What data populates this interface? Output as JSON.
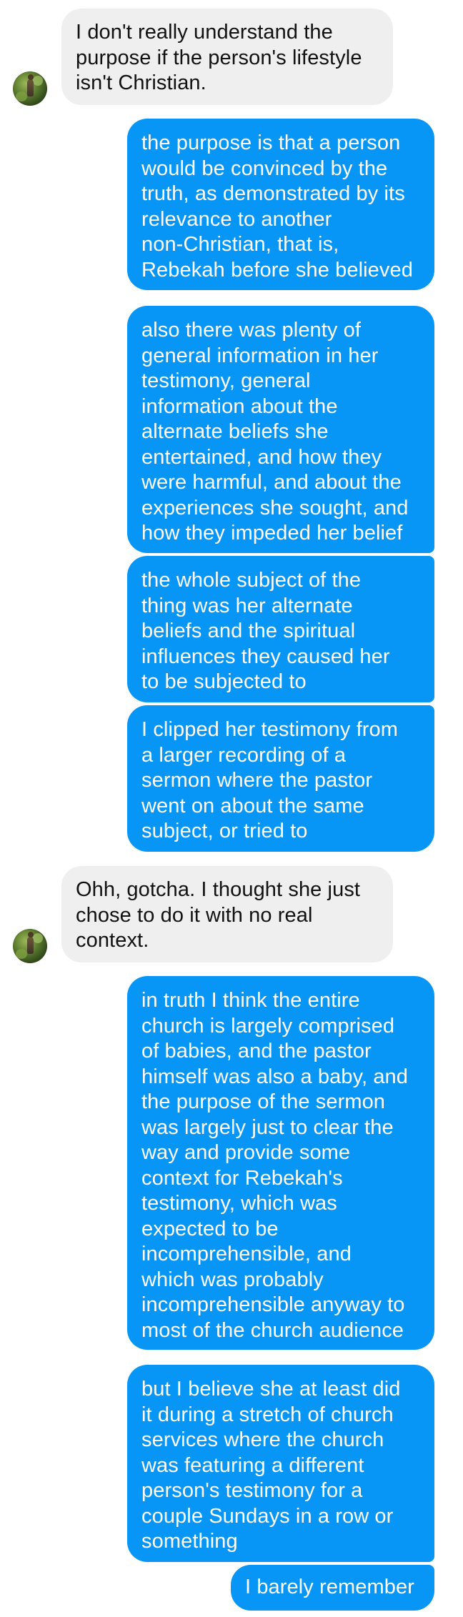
{
  "conversation": {
    "messages": [
      {
        "from": "other",
        "text": "I don't really understand the\npurpose if the person's lifestyle\nisn't Christian."
      },
      {
        "from": "me",
        "text": "the purpose is that a person\nwould be convinced by the\ntruth, as demonstrated by its\nrelevance to another\nnon-Christian, that is,\nRebekah before she believed"
      },
      {
        "from": "me",
        "text": "also there was plenty of\ngeneral information in her\ntestimony, general\ninformation about the\nalternate beliefs she\nentertained, and how they\nwere harmful, and about the\nexperiences she sought, and\nhow they impeded her belief"
      },
      {
        "from": "me",
        "text": "the whole subject of the\nthing was her alternate\nbeliefs and the spiritual\ninfluences they caused her\nto be subjected to"
      },
      {
        "from": "me",
        "text": "I clipped her testimony from\na larger recording of a\nsermon where the pastor\nwent on about the same\nsubject, or tried to"
      },
      {
        "from": "other",
        "text": "Ohh, gotcha. I thought she just\nchose to do it with no real\ncontext."
      },
      {
        "from": "me",
        "text": "in truth I think the entire\nchurch is largely comprised\nof babies, and the pastor\nhimself was also a baby, and\nthe purpose of the sermon\nwas largely just to clear the\nway and provide some\ncontext for Rebekah's\ntestimony, which was\nexpected to be\nincomprehensible, and\nwhich was probably\nincomprehensible anyway to\nmost of the church audience"
      },
      {
        "from": "me",
        "text": "but I believe she at least did\nit during a stretch of church\nservices where the church\nwas featuring a different\nperson's testimony for a\ncouple Sundays in a row or\nsomething"
      },
      {
        "from": "me",
        "text": "I barely remember"
      }
    ]
  },
  "colors": {
    "sent_bubble": "#0896f6",
    "received_bubble": "#efefef",
    "sent_text": "#ffffff",
    "received_text": "#111111"
  },
  "icons": {
    "contact_avatar": "avatar-icon"
  }
}
